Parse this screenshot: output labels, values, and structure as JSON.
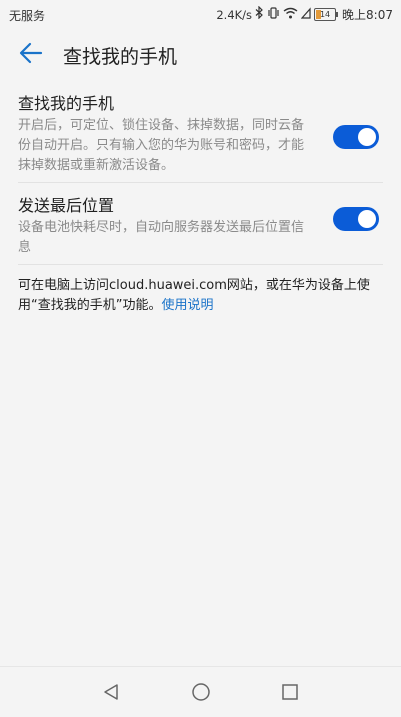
{
  "status_bar": {
    "carrier": "无服务",
    "speed": "2.4K/s",
    "battery": "14",
    "time": "晚上8:07",
    "icons": [
      "bluetooth-icon",
      "vibrate-icon",
      "wifi-icon",
      "signal-icon",
      "battery-icon"
    ]
  },
  "header": {
    "title": "查找我的手机",
    "back_icon": "back-arrow-icon"
  },
  "settings": [
    {
      "title": "查找我的手机",
      "description": "开启后，可定位、锁住设备、抹掉数据，同时云备份自动开启。只有输入您的华为账号和密码，才能抹掉数据或重新激活设备。",
      "enabled": true
    },
    {
      "title": "发送最后位置",
      "description": "设备电池快耗尽时，自动向服务器发送最后位置信息",
      "enabled": true
    }
  ],
  "note": {
    "text": "可在电脑上访问cloud.huawei.com网站，或在华为设备上使用“查找我的手机”功能。",
    "link": "使用说明"
  },
  "nav": {
    "back": "nav-back-icon",
    "home": "nav-home-icon",
    "recents": "nav-recents-icon"
  },
  "colors": {
    "accent": "#0b5cd7",
    "link": "#1a73c9",
    "background": "#f4f4f4"
  }
}
